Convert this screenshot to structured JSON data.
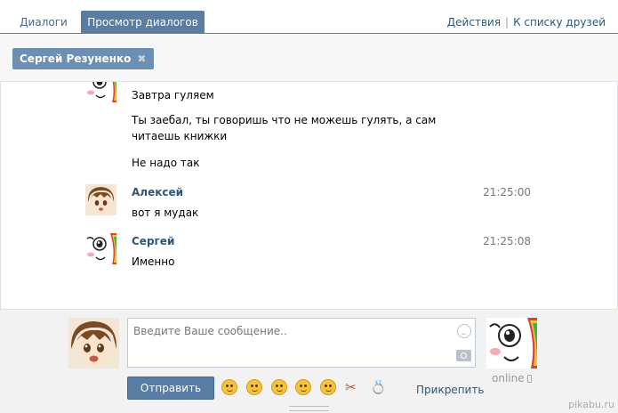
{
  "tabs": [
    {
      "label": "Диалоги",
      "active": false
    },
    {
      "label": "Просмотр диалогов",
      "active": true
    }
  ],
  "top_actions": {
    "actions": "Действия",
    "separator": "|",
    "friends": "К списку друзей"
  },
  "filter": {
    "chip_label": "Сергей Резуненко",
    "remove_glyph": "✖"
  },
  "messages": {
    "m1_text": "Завтра гуляем",
    "m2_text": "Ты заебал, ты говоришь что не можешь гулять, а сам читаешь книжки",
    "m3_text": "Не надо так",
    "m4_name": "Алексей",
    "m4_time": "21:25:00",
    "m4_text": "вот я мудак",
    "m5_name": "Сергей",
    "m5_time": "21:25:08",
    "m5_text": "Именно"
  },
  "composer": {
    "placeholder": "Введите Ваше сообщение..",
    "send_label": "Отправить",
    "attach_label": "Прикрепить",
    "status": "online",
    "scissors": "✂",
    "ring": "💍"
  },
  "watermark": "pikabu.ru",
  "icons": [
    "smile-icon",
    "camera-icon",
    "phone-icon",
    "close-icon"
  ],
  "colors": {
    "accent": "#597da3",
    "link": "#2b587a",
    "name": "#2b587a"
  }
}
